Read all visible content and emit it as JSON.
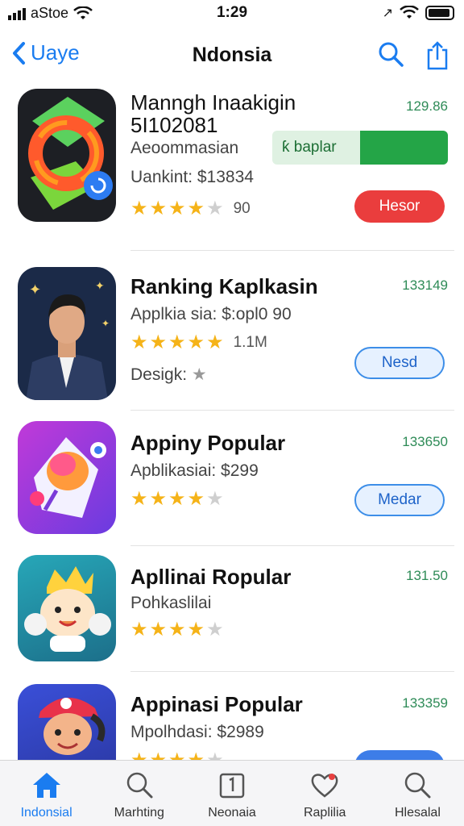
{
  "status": {
    "carrier": "aStoe",
    "time": "1:29"
  },
  "nav": {
    "back_label": "Uaye",
    "title": "Ndonsia"
  },
  "featured": {
    "name_line1": "Manngh Inaakigin",
    "name_line2": "5I102081",
    "category": "Aeoommasian",
    "rank": "Uankint: $13834",
    "progress_label": "ƙ baplar",
    "progress_fraction": 0.5,
    "rating": 3.5,
    "rating_count": "90",
    "side_number": "129.86",
    "button": "Hesor"
  },
  "apps": [
    {
      "name": "Ranking Kaplkasin",
      "sub": "Applkia sia: $:opl0 90",
      "rating": 4.5,
      "rating_count": "1.1M",
      "extra": "Desigk:",
      "side_number": "133149",
      "button": "Nesd"
    },
    {
      "name": "Appiny Popular",
      "sub": "Apblikasiai: $299",
      "rating": 4,
      "rating_count": "",
      "side_number": "133650",
      "button": "Medar"
    },
    {
      "name": "Apllinai Ropular",
      "sub": "Pohkaslilai",
      "rating": 3.5,
      "rating_count": "",
      "side_number": "131.50",
      "button": ""
    },
    {
      "name": "Appinasi Popular",
      "sub": "Mpolhdasi: $2989",
      "rating": 4,
      "rating_count": "",
      "side_number": "133359",
      "button": ""
    }
  ],
  "tabs": [
    {
      "label": "Indonsial",
      "icon": "home-icon"
    },
    {
      "label": "Marhting",
      "icon": "search-icon"
    },
    {
      "label": "Neonaia",
      "icon": "calendar-icon"
    },
    {
      "label": "Raplilia",
      "icon": "heart-icon"
    },
    {
      "label": "Hlesalal",
      "icon": "search-icon"
    }
  ],
  "colors": {
    "accent": "#1a7cf0",
    "green": "#24a547",
    "red": "#ea3d3d",
    "star": "#f5b318"
  }
}
